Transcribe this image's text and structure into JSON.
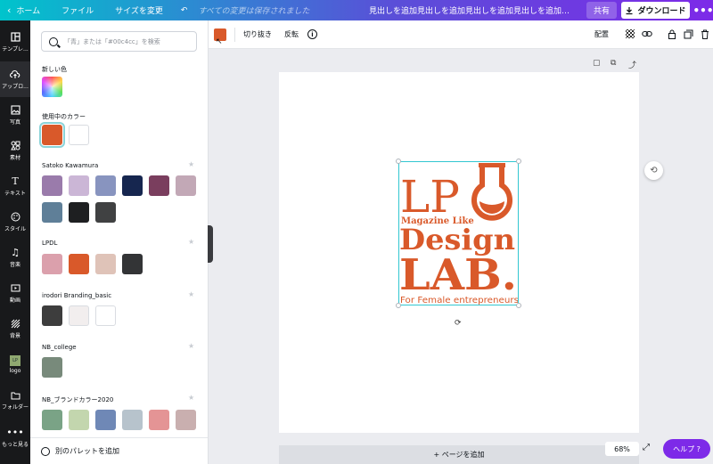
{
  "topbar": {
    "home": "ホーム",
    "file": "ファイル",
    "resize": "サイズを変更",
    "undo_icon": "undo-icon",
    "saved_status": "すべての変更は保存されました",
    "doc_title": "見出しを追加見出しを追加見出しを追加見出しを追加見出しを...",
    "share": "共有",
    "download": "ダウンロード",
    "more": "•••"
  },
  "rail": {
    "items": [
      {
        "label": "テンプレ...",
        "icon": "template-icon"
      },
      {
        "label": "アップロ...",
        "icon": "cloud-upload-icon"
      },
      {
        "label": "写真",
        "icon": "photo-icon"
      },
      {
        "label": "素材",
        "icon": "elements-icon"
      },
      {
        "label": "テキスト",
        "icon": "text-icon"
      },
      {
        "label": "スタイル",
        "icon": "palette-icon"
      },
      {
        "label": "音楽",
        "icon": "music-icon"
      },
      {
        "label": "動画",
        "icon": "video-icon"
      },
      {
        "label": "背景",
        "icon": "background-icon"
      },
      {
        "label": "logo",
        "icon": "logo-icon"
      },
      {
        "label": "フォルダー",
        "icon": "folder-icon"
      },
      {
        "label": "もっと見る",
        "icon": "more-icon"
      }
    ]
  },
  "panel": {
    "search_placeholder": "「青」または「#00c4cc」を検索",
    "new_color_title": "新しい色",
    "in_use_title": "使用中のカラー",
    "in_use": [
      "#d9592a",
      "#ffffff"
    ],
    "palettes": [
      {
        "name": "Satoko Kawamura",
        "colors": [
          "#9a7bab",
          "#cbb6d6",
          "#8894bf",
          "#16264f",
          "#7a3e5e",
          "#c2a8b6",
          "#5f7f98",
          "#1e1f21",
          "#404142"
        ]
      },
      {
        "name": "LPDL",
        "colors": [
          "#dba0ac",
          "#d9592a",
          "#dfc3b8",
          "#333436"
        ]
      },
      {
        "name": "irodori Branding_basic",
        "colors": [
          "#3d3d3d",
          "#f2eeee",
          "#ffffff"
        ]
      },
      {
        "name": "NB_college",
        "colors": [
          "#788a7b"
        ]
      },
      {
        "name": "NB_ブランドカラー2020",
        "colors": [
          "#7aa386",
          "#c3d6ae",
          "#6f88b6",
          "#b7c3cc",
          "#e49495",
          "#c9afaf"
        ]
      }
    ],
    "add_palette": "別のパレットを追加"
  },
  "toolbar": {
    "crop": "切り抜き",
    "flip": "反転",
    "position": "配置",
    "selected_color": "#d9592a"
  },
  "logo": {
    "line1": "LP",
    "tagline": "Magazine Like",
    "line2": "Design",
    "line3": "LAB.",
    "subtitle": "For Female entrepreneurs",
    "color": "#d9592a"
  },
  "canvas": {
    "add_page": "+ ページを追加",
    "zoom": "68%",
    "help": "ヘルプ ?"
  }
}
